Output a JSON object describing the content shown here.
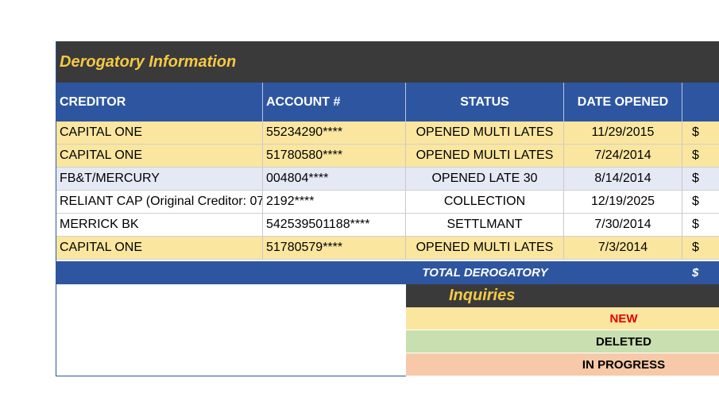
{
  "section_title": "Derogatory Information",
  "columns": {
    "creditor": "CREDITOR",
    "account": "ACCOUNT #",
    "status": "STATUS",
    "date_opened": "DATE OPENED"
  },
  "rows": [
    {
      "creditor": "CAPITAL ONE",
      "account": "55234290****",
      "status": "OPENED MULTI LATES",
      "date_opened": "11/29/2015",
      "amount": "$",
      "color": "#fbe6a0"
    },
    {
      "creditor": "CAPITAL ONE",
      "account": "51780580****",
      "status": "OPENED MULTI LATES",
      "date_opened": "7/24/2014",
      "amount": "$",
      "color": "#fbe6a0"
    },
    {
      "creditor": "FB&T/MERCURY",
      "account": "004804****",
      "status": "OPENED LATE 30",
      "date_opened": "8/14/2014",
      "amount": "$",
      "color": "#e4e9f5"
    },
    {
      "creditor": "RELIANT CAP  (Original Creditor: 07",
      "account": "2192****",
      "status": "COLLECTION",
      "date_opened": "12/19/2025",
      "amount": "$",
      "color": "#ffffff"
    },
    {
      "creditor": "MERRICK BK",
      "account": "542539501188****",
      "status": "SETTLMANT",
      "date_opened": "7/30/2014",
      "amount": "$",
      "color": "#ffffff"
    },
    {
      "creditor": "CAPITAL ONE",
      "account": "51780579****",
      "status": "OPENED MULTI LATES",
      "date_opened": "7/3/2014",
      "amount": "$",
      "color": "#fbe6a0"
    }
  ],
  "total": {
    "label": "TOTAL DEROGATORY",
    "amount": "$"
  },
  "inquiries": {
    "title": "Inquiries",
    "legend": [
      {
        "label": "NEW",
        "text_color": "#e00000",
        "bg": "#fbe6a0"
      },
      {
        "label": "DELETED",
        "text_color": "#000000",
        "bg": "#c8dfb0"
      },
      {
        "label": "IN PROGRESS",
        "text_color": "#000000",
        "bg": "#f7c9a8"
      }
    ]
  }
}
